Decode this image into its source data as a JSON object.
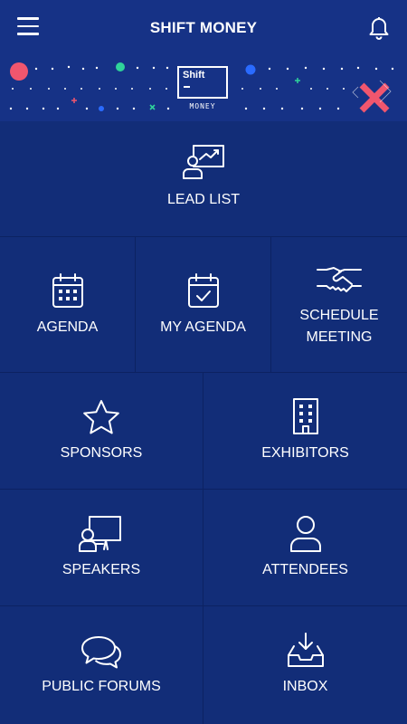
{
  "header": {
    "title": "SHIFT MONEY",
    "menu_icon": "hamburger-menu-icon",
    "bell_icon": "bell-icon"
  },
  "banner": {
    "logo_text": "Shift",
    "logo_subtitle": "MONEY"
  },
  "colors": {
    "background": "#122d78",
    "header": "#163286",
    "divider": "#0c2262",
    "accent_pink": "#f0566e",
    "accent_green": "#2fd39a",
    "accent_blue": "#2a6bff"
  },
  "tiles": {
    "lead_list": {
      "label": "LEAD LIST",
      "icon": "presentation-user-icon"
    },
    "agenda": {
      "label": "AGENDA",
      "icon": "calendar-grid-icon"
    },
    "my_agenda": {
      "label": "MY AGENDA",
      "icon": "calendar-check-icon"
    },
    "schedule_meeting": {
      "label_line1": "SCHEDULE",
      "label_line2": "MEETING",
      "icon": "handshake-icon"
    },
    "sponsors": {
      "label": "SPONSORS",
      "icon": "star-icon"
    },
    "exhibitors": {
      "label": "EXHIBITORS",
      "icon": "building-icon"
    },
    "speakers": {
      "label": "SPEAKERS",
      "icon": "speaker-board-icon"
    },
    "attendees": {
      "label": "ATTENDEES",
      "icon": "person-icon"
    },
    "public_forums": {
      "label": "PUBLIC FORUMS",
      "icon": "chat-bubbles-icon"
    },
    "inbox": {
      "label": "INBOX",
      "icon": "inbox-download-icon"
    }
  }
}
